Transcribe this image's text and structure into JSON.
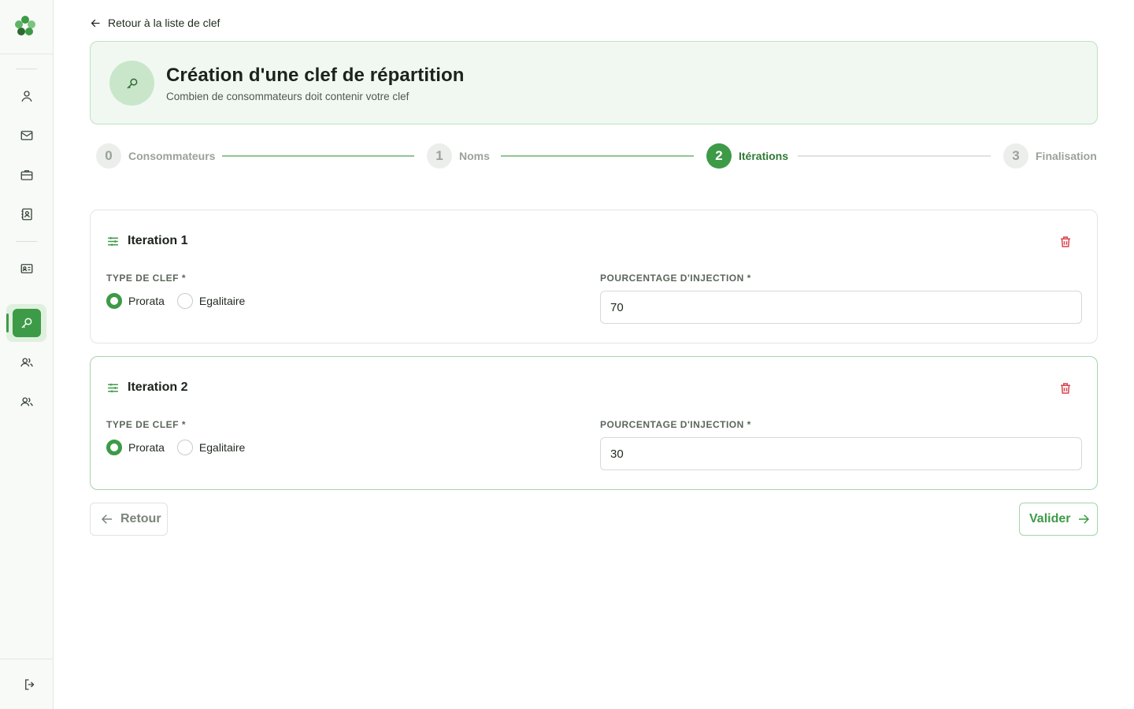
{
  "nav": {
    "back_link": "Retour à la liste de clef"
  },
  "header": {
    "title": "Création d'une clef de répartition",
    "subtitle": "Combien de consommateurs doit contenir votre clef"
  },
  "stepper": {
    "steps": [
      {
        "number": "0",
        "label": "Consommateurs",
        "state": "done"
      },
      {
        "number": "1",
        "label": "Noms",
        "state": "done"
      },
      {
        "number": "2",
        "label": "Itérations",
        "state": "active"
      },
      {
        "number": "3",
        "label": "Finalisation",
        "state": "todo"
      }
    ]
  },
  "iterations": [
    {
      "title": "Iteration 1",
      "key_type_label": "TYPE DE CLEF *",
      "options": [
        "Prorata",
        "Egalitaire"
      ],
      "selected": "Prorata",
      "injection_label": "POURCENTAGE D'INJECTION *",
      "injection_value": "70"
    },
    {
      "title": "Iteration 2",
      "key_type_label": "TYPE DE CLEF *",
      "options": [
        "Prorata",
        "Egalitaire"
      ],
      "selected": "Prorata",
      "injection_label": "POURCENTAGE D'INJECTION *",
      "injection_value": "30"
    }
  ],
  "buttons": {
    "back": "Retour",
    "validate": "Valider"
  },
  "sidebar": {
    "items": [
      "user-icon",
      "mail-icon",
      "briefcase-icon",
      "contact-book-icon",
      "id-card-icon",
      "key-icon",
      "users-icon",
      "users-group-icon"
    ],
    "active": "key-icon",
    "logout": "logout-icon"
  },
  "colors": {
    "accent": "#3d9a47",
    "accent_light": "#dff0df",
    "danger": "#d9434f"
  }
}
